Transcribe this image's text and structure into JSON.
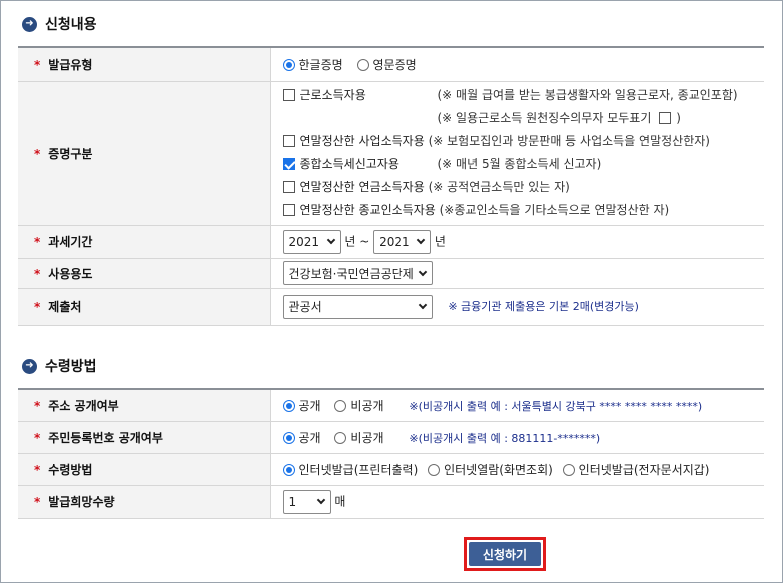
{
  "section1": {
    "title": "신청내용",
    "rows": {
      "issue_type": {
        "label": "발급유형",
        "options": [
          "한글증명",
          "영문증명"
        ],
        "selected": "한글증명"
      },
      "cert_type": {
        "label": "증명구분",
        "items": [
          {
            "label": "근로소득자용",
            "note": "(※ 매월 급여를 받는 봉급생활자와 일용근로자, 종교인포함)",
            "checked": false
          },
          {
            "label": "",
            "note": "(※ 일용근로소득 원천징수의무자 모두표기",
            "note_end": ")",
            "checked": false
          },
          {
            "label": "연말정산한 사업소득자용",
            "note": "(※ 보험모집인과 방문판매 등 사업소득을 연말정산한자)",
            "checked": false
          },
          {
            "label": "종합소득세신고자용",
            "note": "(※ 매년 5월 종합소득세 신고자)",
            "checked": true
          },
          {
            "label": "연말정산한 연금소득자용",
            "note": "(※ 공적연금소득만 있는 자)",
            "checked": false
          },
          {
            "label": "연말정산한 종교인소득자용",
            "note": "(※종교인소득을 기타소득으로 연말정산한 자)",
            "checked": false
          }
        ]
      },
      "tax_period": {
        "label": "과세기간",
        "from_year": "2021",
        "year_unit": "년",
        "tilde": "~",
        "to_year": "2021"
      },
      "usage": {
        "label": "사용용도",
        "value": "건강보험·국민연금공단제출용"
      },
      "submit_to": {
        "label": "제출처",
        "value": "관공서",
        "note": "※ 금융기관 제출용은 기본 2매(변경가능)"
      }
    }
  },
  "section2": {
    "title": "수령방법",
    "rows": {
      "addr_disclosure": {
        "label": "주소 공개여부",
        "options": [
          "공개",
          "비공개"
        ],
        "selected": "공개",
        "note": "※(비공개시 출력 예 : 서울특별시 강북구 **** **** **** ****)"
      },
      "rrn_disclosure": {
        "label": "주민등록번호 공개여부",
        "options": [
          "공개",
          "비공개"
        ],
        "selected": "공개",
        "note": "※(비공개시 출력 예 : 881111-*******)"
      },
      "receive_method": {
        "label": "수령방법",
        "options": [
          "인터넷발급(프린터출력)",
          "인터넷열람(화면조회)",
          "인터넷발급(전자문서지갑)"
        ],
        "selected": "인터넷발급(프린터출력)"
      },
      "copies": {
        "label": "발급희망수량",
        "value": "1",
        "unit": "매"
      }
    }
  },
  "apply_button": "신청하기",
  "colors": {
    "accent_blue": "#3d5f96",
    "required_red": "#d0101a",
    "note_blue": "#1c2f8c",
    "highlight_red": "#e01b1b"
  }
}
